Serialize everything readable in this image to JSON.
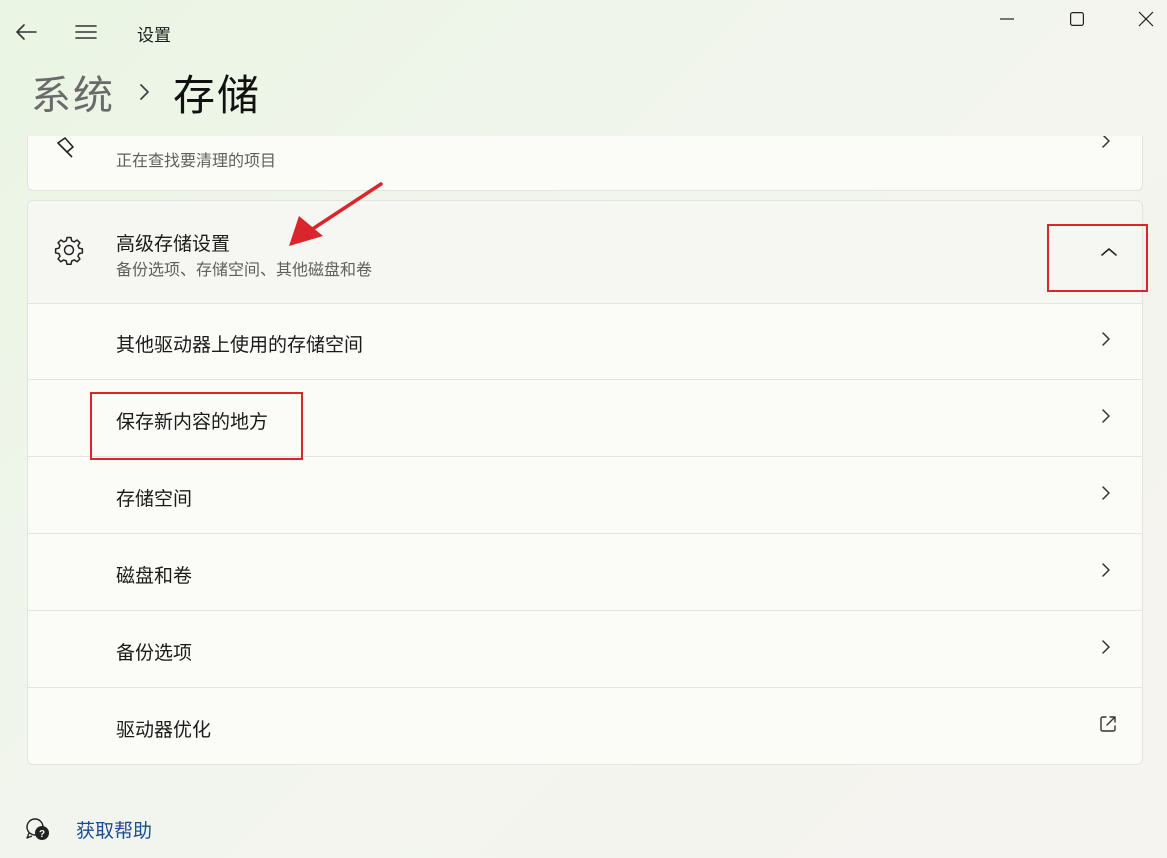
{
  "window": {
    "title": "设置"
  },
  "breadcrumb": {
    "parent": "系统",
    "current": "存储"
  },
  "cleanup_card": {
    "subtitle": "正在查找要清理的项目"
  },
  "advanced": {
    "title": "高级存储设置",
    "subtitle": "备份选项、存储空间、其他磁盘和卷",
    "items": [
      {
        "label": "其他驱动器上使用的存储空间",
        "icon": "chevron-right-icon"
      },
      {
        "label": "保存新内容的地方",
        "icon": "chevron-right-icon"
      },
      {
        "label": "存储空间",
        "icon": "chevron-right-icon"
      },
      {
        "label": "磁盘和卷",
        "icon": "chevron-right-icon"
      },
      {
        "label": "备份选项",
        "icon": "chevron-right-icon"
      },
      {
        "label": "驱动器优化",
        "icon": "open-external-icon"
      }
    ]
  },
  "help": {
    "label": "获取帮助"
  },
  "annotation": {
    "color": "#d9262c"
  }
}
